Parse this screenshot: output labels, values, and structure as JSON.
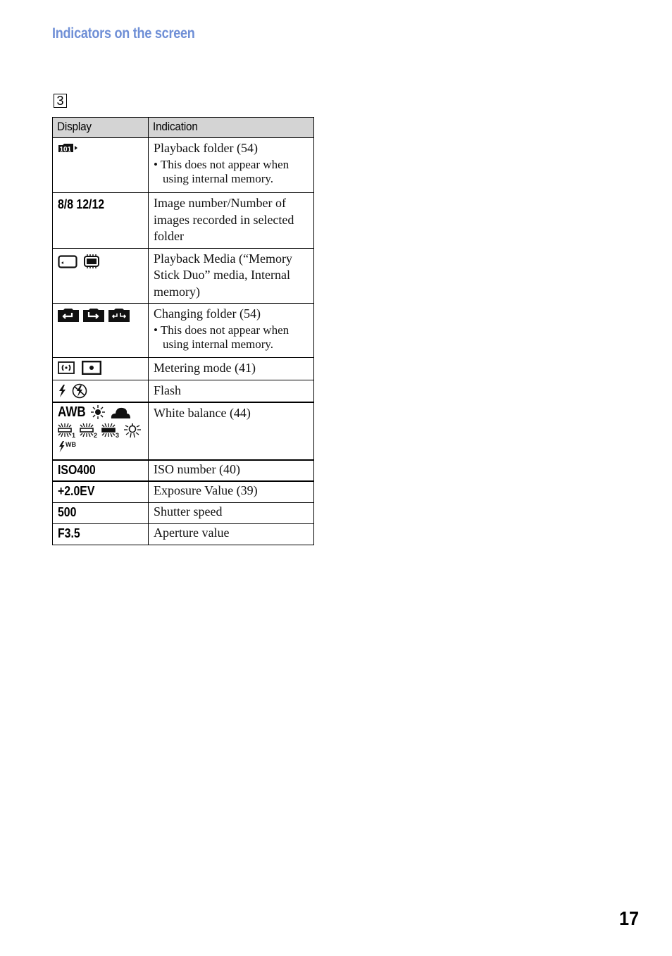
{
  "page": {
    "section_title": "Indicators on the screen",
    "section_number": "3",
    "page_number": "17",
    "accent_color": "#6f8fd6"
  },
  "table": {
    "headers": {
      "display": "Display",
      "indication": "Indication"
    },
    "rows": [
      {
        "display_icons": [
          "playback-folder-101-icon"
        ],
        "indication": "Playback folder (54)",
        "note": "This does not appear when using internal memory."
      },
      {
        "display_text": "8/8 12/12",
        "indication": "Image number/Number of images recorded in selected folder"
      },
      {
        "display_icons": [
          "memory-stick-duo-icon",
          "internal-memory-icon"
        ],
        "indication": "Playback Media (“Memory Stick Duo” media, Internal memory)"
      },
      {
        "display_icons": [
          "previous-folder-icon",
          "next-folder-icon",
          "prev-next-folder-icon"
        ],
        "indication": "Changing folder (54)",
        "note": "This does not appear when using internal memory."
      },
      {
        "display_icons": [
          "center-weighted-metering-icon",
          "spot-metering-icon"
        ],
        "indication": "Metering mode (41)"
      },
      {
        "display_icons": [
          "flash-icon",
          "flash-off-icon"
        ],
        "indication": "Flash"
      },
      {
        "display_icons": [
          "awb-icon",
          "daylight-icon",
          "cloudy-icon",
          "fluorescent-1-icon",
          "fluorescent-2-icon",
          "fluorescent-3-icon",
          "incandescent-icon",
          "flash-wb-icon"
        ],
        "awb_label": "AWB",
        "indication": "White balance (44)"
      },
      {
        "display_text": "ISO400",
        "indication": "ISO number (40)"
      },
      {
        "display_text": "+2.0EV",
        "indication": "Exposure Value (39)"
      },
      {
        "display_text": "500",
        "indication": "Shutter speed"
      },
      {
        "display_text": "F3.5",
        "indication": "Aperture value"
      }
    ],
    "bullet": "•"
  }
}
